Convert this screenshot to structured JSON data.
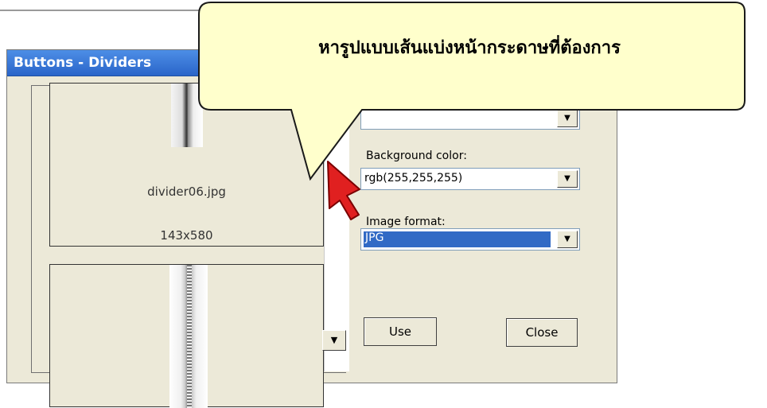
{
  "window": {
    "title": "Buttons - Dividers"
  },
  "list": {
    "items": [
      {
        "filename": "divider06.jpg",
        "size": "143x580"
      },
      {
        "filename": "",
        "size": ""
      }
    ]
  },
  "form": {
    "background_label": "Background color:",
    "background_value": "rgb(255,255,255)",
    "format_label": "Image format:",
    "format_value": "JPG"
  },
  "buttons": {
    "use": "Use",
    "close": "Close"
  },
  "callout": {
    "text": "หารูปแบบเส้นแบ่งหน้ากระดาษที่ต้องการ",
    "fill": "#ffffcc",
    "stroke": "#1a1a1a"
  },
  "colors": {
    "titlebar": "#2a65c9",
    "selection": "#316ac5",
    "cursor": "#e02020"
  },
  "icons": [
    "chevron-down-icon",
    "pointer-cursor-icon"
  ]
}
